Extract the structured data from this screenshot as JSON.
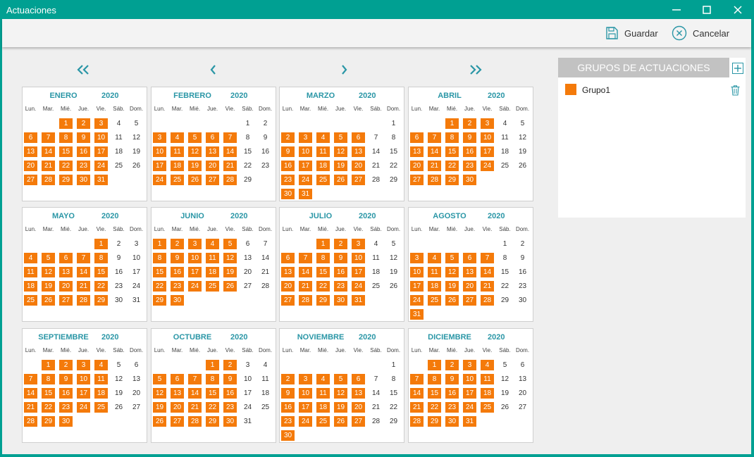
{
  "window": {
    "title": "Actuaciones"
  },
  "toolbar": {
    "save_label": "Guardar",
    "cancel_label": "Cancelar"
  },
  "weekdays": [
    "Lun.",
    "Mar.",
    "Mié.",
    "Jue.",
    "Vie.",
    "Sáb.",
    "Dom."
  ],
  "months": [
    {
      "name": "ENERO",
      "year": "2020",
      "offset": 2,
      "days": 31,
      "selected": [
        1,
        2,
        3,
        6,
        7,
        8,
        9,
        10,
        13,
        14,
        15,
        16,
        17,
        20,
        21,
        22,
        23,
        24,
        27,
        28,
        29,
        30,
        31
      ]
    },
    {
      "name": "FEBRERO",
      "year": "2020",
      "offset": 5,
      "days": 29,
      "selected": [
        3,
        4,
        5,
        6,
        7,
        10,
        11,
        12,
        13,
        14,
        17,
        18,
        19,
        20,
        21,
        24,
        25,
        26,
        27,
        28
      ]
    },
    {
      "name": "MARZO",
      "year": "2020",
      "offset": 6,
      "days": 31,
      "selected": [
        2,
        3,
        4,
        5,
        6,
        9,
        10,
        11,
        12,
        13,
        16,
        17,
        18,
        19,
        20,
        23,
        24,
        25,
        26,
        27,
        30,
        31
      ]
    },
    {
      "name": "ABRIL",
      "year": "2020",
      "offset": 2,
      "days": 30,
      "selected": [
        1,
        2,
        3,
        6,
        7,
        8,
        9,
        10,
        13,
        14,
        15,
        16,
        17,
        20,
        21,
        22,
        23,
        24,
        27,
        28,
        29,
        30
      ]
    },
    {
      "name": "MAYO",
      "year": "2020",
      "offset": 4,
      "days": 31,
      "selected": [
        1,
        4,
        5,
        6,
        7,
        8,
        11,
        12,
        13,
        14,
        15,
        18,
        19,
        20,
        21,
        22,
        25,
        26,
        27,
        28,
        29
      ]
    },
    {
      "name": "JUNIO",
      "year": "2020",
      "offset": 0,
      "days": 30,
      "selected": [
        1,
        2,
        3,
        4,
        5,
        8,
        9,
        10,
        11,
        12,
        15,
        16,
        17,
        18,
        19,
        22,
        23,
        24,
        25,
        26,
        29,
        30
      ]
    },
    {
      "name": "JULIO",
      "year": "2020",
      "offset": 2,
      "days": 31,
      "selected": [
        1,
        2,
        3,
        6,
        7,
        8,
        9,
        10,
        13,
        14,
        15,
        16,
        17,
        20,
        21,
        22,
        23,
        24,
        27,
        28,
        29,
        30,
        31
      ]
    },
    {
      "name": "AGOSTO",
      "year": "2020",
      "offset": 5,
      "days": 31,
      "selected": [
        3,
        4,
        5,
        6,
        7,
        10,
        11,
        12,
        13,
        14,
        17,
        18,
        19,
        20,
        21,
        24,
        25,
        26,
        27,
        28,
        31
      ]
    },
    {
      "name": "SEPTIEMBRE",
      "year": "2020",
      "offset": 1,
      "days": 30,
      "selected": [
        1,
        2,
        3,
        4,
        7,
        8,
        9,
        10,
        11,
        14,
        15,
        16,
        17,
        18,
        21,
        22,
        23,
        24,
        25,
        28,
        29,
        30
      ]
    },
    {
      "name": "OCTUBRE",
      "year": "2020",
      "offset": 3,
      "days": 31,
      "selected": [
        1,
        2,
        5,
        6,
        7,
        8,
        9,
        12,
        13,
        14,
        15,
        16,
        19,
        20,
        21,
        22,
        23,
        26,
        27,
        28,
        29,
        30
      ]
    },
    {
      "name": "NOVIEMBRE",
      "year": "2020",
      "offset": 6,
      "days": 30,
      "selected": [
        2,
        3,
        4,
        5,
        6,
        9,
        10,
        11,
        12,
        13,
        16,
        17,
        18,
        19,
        20,
        23,
        24,
        25,
        26,
        27,
        30
      ]
    },
    {
      "name": "DICIEMBRE",
      "year": "2020",
      "offset": 1,
      "days": 31,
      "selected": [
        1,
        2,
        3,
        4,
        7,
        8,
        9,
        10,
        11,
        14,
        15,
        16,
        17,
        18,
        21,
        22,
        23,
        24,
        25,
        28,
        29,
        30,
        31
      ]
    }
  ],
  "groups_panel": {
    "title": "GRUPOS DE ACTUACIONES",
    "groups": [
      {
        "name": "Grupo1",
        "color": "#f47a0a"
      }
    ]
  },
  "colors": {
    "accent": "#00a092",
    "selected_day": "#f47a0a",
    "month_title": "#2a96a6"
  }
}
